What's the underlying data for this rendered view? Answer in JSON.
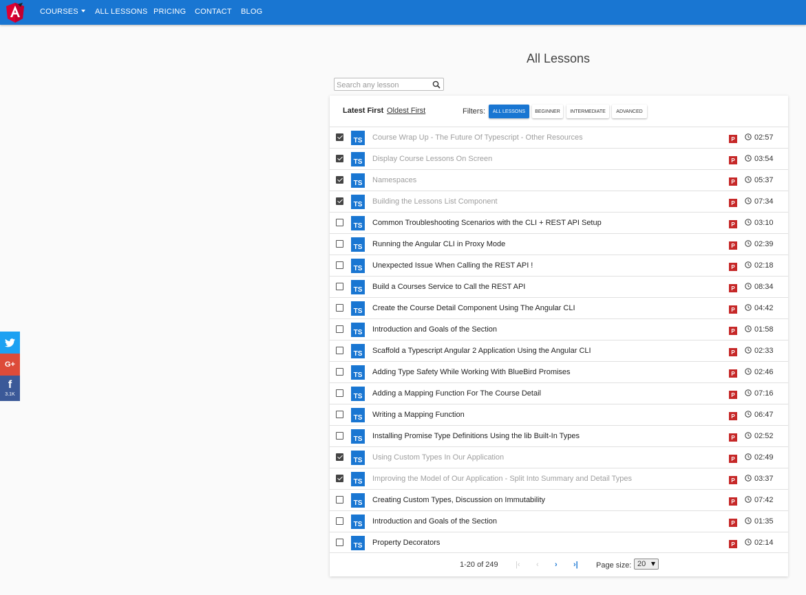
{
  "nav": {
    "items": [
      {
        "label": "COURSES"
      },
      {
        "label": "ALL LESSONS"
      },
      {
        "label": "PRICING"
      },
      {
        "label": "CONTACT"
      },
      {
        "label": "BLOG"
      }
    ],
    "brand_color": "#1976d2"
  },
  "social": {
    "twitter_icon": "twitter-icon",
    "gplus_label": "G+",
    "facebook_icon": "facebook-icon",
    "facebook_count": "3.1K"
  },
  "page": {
    "title": "All Lessons"
  },
  "search": {
    "placeholder": "Search any lesson",
    "value": ""
  },
  "sort": {
    "active": "Latest First",
    "inactive": "Oldest First"
  },
  "filters": {
    "label": "Filters:",
    "options": [
      "ALL LESSONS",
      "BEGINNER",
      "INTERMEDIATE",
      "ADVANCED"
    ],
    "selected": "ALL LESSONS"
  },
  "lessons": [
    {
      "checked": true,
      "badge": "TS",
      "title": "Course Wrap Up - The Future Of Typescript - Other Resources",
      "pro": "P",
      "duration": "02:57"
    },
    {
      "checked": true,
      "badge": "TS",
      "title": "Display Course Lessons On Screen",
      "pro": "P",
      "duration": "03:54"
    },
    {
      "checked": true,
      "badge": "TS",
      "title": "Namespaces",
      "pro": "P",
      "duration": "05:37"
    },
    {
      "checked": true,
      "badge": "TS",
      "title": "Building the Lessons List Component",
      "pro": "P",
      "duration": "07:34"
    },
    {
      "checked": false,
      "badge": "TS",
      "title": "Common Troubleshooting Scenarios with the CLI + REST API Setup",
      "pro": "P",
      "duration": "03:10"
    },
    {
      "checked": false,
      "badge": "TS",
      "title": "Running the Angular CLI in Proxy Mode",
      "pro": "P",
      "duration": "02:39"
    },
    {
      "checked": false,
      "badge": "TS",
      "title": "Unexpected Issue When Calling the REST API !",
      "pro": "P",
      "duration": "02:18"
    },
    {
      "checked": false,
      "badge": "TS",
      "title": "Build a Courses Service to Call the REST API",
      "pro": "P",
      "duration": "08:34"
    },
    {
      "checked": false,
      "badge": "TS",
      "title": "Create the Course Detail Component Using The Angular CLI",
      "pro": "P",
      "duration": "04:42"
    },
    {
      "checked": false,
      "badge": "TS",
      "title": "Introduction and Goals of the Section",
      "pro": "P",
      "duration": "01:58"
    },
    {
      "checked": false,
      "badge": "TS",
      "title": "Scaffold a Typescript Angular 2 Application Using the Angular CLI",
      "pro": "P",
      "duration": "02:33"
    },
    {
      "checked": false,
      "badge": "TS",
      "title": "Adding Type Safety While Working With BlueBird Promises",
      "pro": "P",
      "duration": "02:46"
    },
    {
      "checked": false,
      "badge": "TS",
      "title": "Adding a Mapping Function For The Course Detail",
      "pro": "P",
      "duration": "07:16"
    },
    {
      "checked": false,
      "badge": "TS",
      "title": "Writing a Mapping Function",
      "pro": "P",
      "duration": "06:47"
    },
    {
      "checked": false,
      "badge": "TS",
      "title": "Installing Promise Type Definitions Using the lib Built-In Types",
      "pro": "P",
      "duration": "02:52"
    },
    {
      "checked": true,
      "badge": "TS",
      "title": "Using Custom Types In Our Application",
      "pro": "P",
      "duration": "02:49"
    },
    {
      "checked": true,
      "badge": "TS",
      "title": "Improving the Model of Our Application - Split Into Summary and Detail Types",
      "pro": "P",
      "duration": "03:37"
    },
    {
      "checked": false,
      "badge": "TS",
      "title": "Creating Custom Types, Discussion on Immutability",
      "pro": "P",
      "duration": "07:42"
    },
    {
      "checked": false,
      "badge": "TS",
      "title": "Introduction and Goals of the Section",
      "pro": "P",
      "duration": "01:35"
    },
    {
      "checked": false,
      "badge": "TS",
      "title": "Property Decorators",
      "pro": "P",
      "duration": "02:14"
    }
  ],
  "paginator": {
    "range": "1-20 of 249",
    "first": "|‹",
    "prev": "‹",
    "next": "›",
    "last": "›|",
    "page_size_label": "Page size:",
    "page_size": "20"
  },
  "colors": {
    "accent": "#1976d2",
    "pro_badge": "#c62828",
    "twitter": "#1da1f2",
    "gplus": "#dd4b39",
    "facebook": "#3b5998"
  }
}
